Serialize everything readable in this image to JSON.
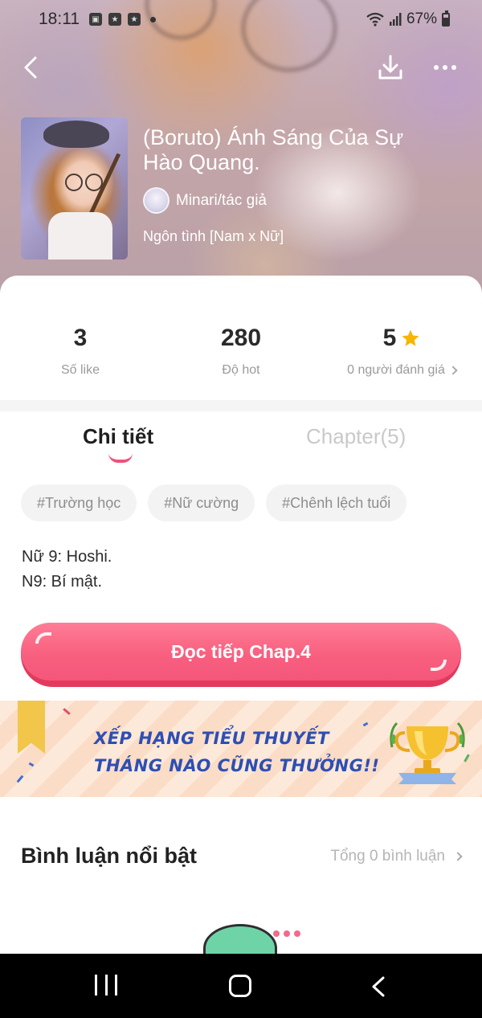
{
  "status_bar": {
    "time": "18:11",
    "battery": "67%"
  },
  "story": {
    "title": "(Boruto) Ánh Sáng Của Sự Hào Quang.",
    "author": "Minari/tác giả",
    "genre": "Ngôn tình [Nam x Nữ]"
  },
  "stats": [
    {
      "value": "3",
      "label": "Số like"
    },
    {
      "value": "280",
      "label": "Độ hot"
    },
    {
      "value": "5",
      "label": "0 người đánh giá"
    }
  ],
  "tabs": {
    "detail": "Chi tiết",
    "chapters": "Chapter(5)"
  },
  "tags": [
    "#Trường học",
    "#Nữ cường",
    "#Chênh lệch tuổi"
  ],
  "description": [
    "Nữ 9: Hoshi.",
    "N9: Bí mật."
  ],
  "read_button": "Đọc tiếp Chap.4",
  "banner": {
    "line1": "XẾP HẠNG TIỂU THUYẾT",
    "line2": "THÁNG NÀO CŨNG THƯỞNG!!"
  },
  "comments": {
    "title": "Bình luận nổi bật",
    "total": "Tổng 0 bình luận"
  },
  "colors": {
    "accent": "#f8607f",
    "banner_text": "#2d4fb3",
    "star": "#f7b500"
  }
}
